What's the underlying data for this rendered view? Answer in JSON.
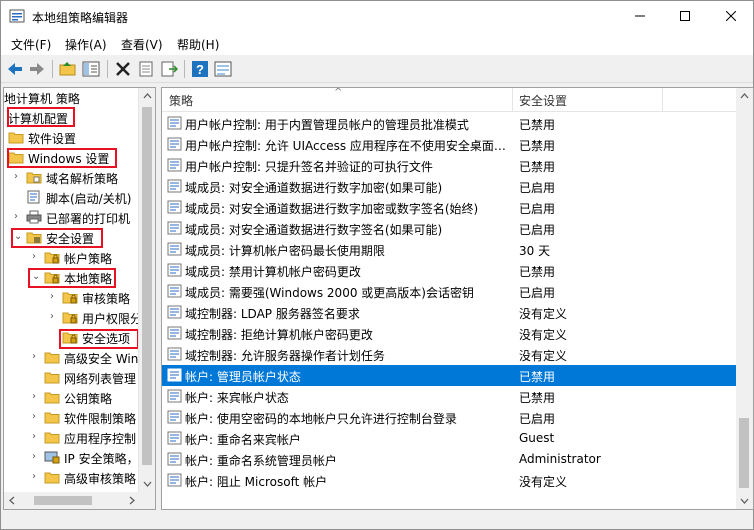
{
  "window": {
    "title": "本地组策略编辑器"
  },
  "menu": [
    "文件(F)",
    "操作(A)",
    "查看(V)",
    "帮助(H)"
  ],
  "toolbar": [
    "back-icon",
    "forward-icon",
    "up-folder-icon",
    "show-tree-icon",
    "delete-icon",
    "properties-icon",
    "export-icon",
    "help-icon",
    "view-icon"
  ],
  "tree": {
    "root": "地计算机 策略",
    "items": [
      {
        "label": "计算机配置",
        "level": 0,
        "arrow": "",
        "icon": "computer"
      },
      {
        "label": "软件设置",
        "level": 0,
        "arrow": "",
        "icon": "folder"
      },
      {
        "label": "Windows 设置",
        "level": 0,
        "arrow": "",
        "icon": "folder"
      },
      {
        "label": "域名解析策略",
        "level": 1,
        "arrow": ">",
        "icon": "policy-folder"
      },
      {
        "label": "脚本(启动/关机)",
        "level": 1,
        "arrow": "",
        "icon": "script"
      },
      {
        "label": "已部署的打印机",
        "level": 1,
        "arrow": ">",
        "icon": "printer"
      },
      {
        "label": "安全设置",
        "level": 1,
        "arrow": "v",
        "icon": "security"
      },
      {
        "label": "帐户策略",
        "level": 2,
        "arrow": ">",
        "icon": "lock-folder"
      },
      {
        "label": "本地策略",
        "level": 2,
        "arrow": "v",
        "icon": "lock-folder"
      },
      {
        "label": "审核策略",
        "level": 3,
        "arrow": ">",
        "icon": "lock-folder"
      },
      {
        "label": "用户权限分",
        "level": 3,
        "arrow": ">",
        "icon": "lock-folder"
      },
      {
        "label": "安全选项",
        "level": 3,
        "arrow": "",
        "icon": "lock-folder"
      },
      {
        "label": "高级安全 Win",
        "level": 2,
        "arrow": ">",
        "icon": "folder"
      },
      {
        "label": "网络列表管理",
        "level": 2,
        "arrow": "",
        "icon": "folder"
      },
      {
        "label": "公钥策略",
        "level": 2,
        "arrow": ">",
        "icon": "folder"
      },
      {
        "label": "软件限制策略",
        "level": 2,
        "arrow": ">",
        "icon": "folder"
      },
      {
        "label": "应用程序控制",
        "level": 2,
        "arrow": ">",
        "icon": "folder"
      },
      {
        "label": "IP 安全策略，",
        "level": 2,
        "arrow": ">",
        "icon": "ip-security"
      },
      {
        "label": "高级审核策略",
        "level": 2,
        "arrow": ">",
        "icon": "folder"
      }
    ]
  },
  "list": {
    "columns": [
      "策略",
      "安全设置"
    ],
    "rows": [
      {
        "policy": "用户帐户控制: 用于内置管理员帐户的管理员批准模式",
        "setting": "已禁用"
      },
      {
        "policy": "用户帐户控制: 允许 UIAccess 应用程序在不使用安全桌面…",
        "setting": "已禁用"
      },
      {
        "policy": "用户帐户控制: 只提升签名并验证的可执行文件",
        "setting": "已禁用"
      },
      {
        "policy": "域成员: 对安全通道数据进行数字加密(如果可能)",
        "setting": "已启用"
      },
      {
        "policy": "域成员: 对安全通道数据进行数字加密或数字签名(始终)",
        "setting": "已启用"
      },
      {
        "policy": "域成员: 对安全通道数据进行数字签名(如果可能)",
        "setting": "已启用"
      },
      {
        "policy": "域成员: 计算机帐户密码最长使用期限",
        "setting": "30 天"
      },
      {
        "policy": "域成员: 禁用计算机帐户密码更改",
        "setting": "已禁用"
      },
      {
        "policy": "域成员: 需要强(Windows 2000 或更高版本)会话密钥",
        "setting": "已启用"
      },
      {
        "policy": "域控制器: LDAP 服务器签名要求",
        "setting": "没有定义"
      },
      {
        "policy": "域控制器: 拒绝计算机帐户密码更改",
        "setting": "没有定义"
      },
      {
        "policy": "域控制器: 允许服务器操作者计划任务",
        "setting": "没有定义"
      },
      {
        "policy": "帐户: 管理员帐户状态",
        "setting": "已禁用",
        "selected": true
      },
      {
        "policy": "帐户: 来宾帐户状态",
        "setting": "已禁用"
      },
      {
        "policy": "帐户: 使用空密码的本地帐户只允许进行控制台登录",
        "setting": "已启用"
      },
      {
        "policy": "帐户: 重命名来宾帐户",
        "setting": "Guest"
      },
      {
        "policy": "帐户: 重命名系统管理员帐户",
        "setting": "Administrator"
      },
      {
        "policy": "帐户: 阻止 Microsoft 帐户",
        "setting": "没有定义"
      }
    ]
  },
  "colors": {
    "selection": "#0078d7",
    "highlight_box": "#e81123",
    "folder": "#f4c54b"
  }
}
